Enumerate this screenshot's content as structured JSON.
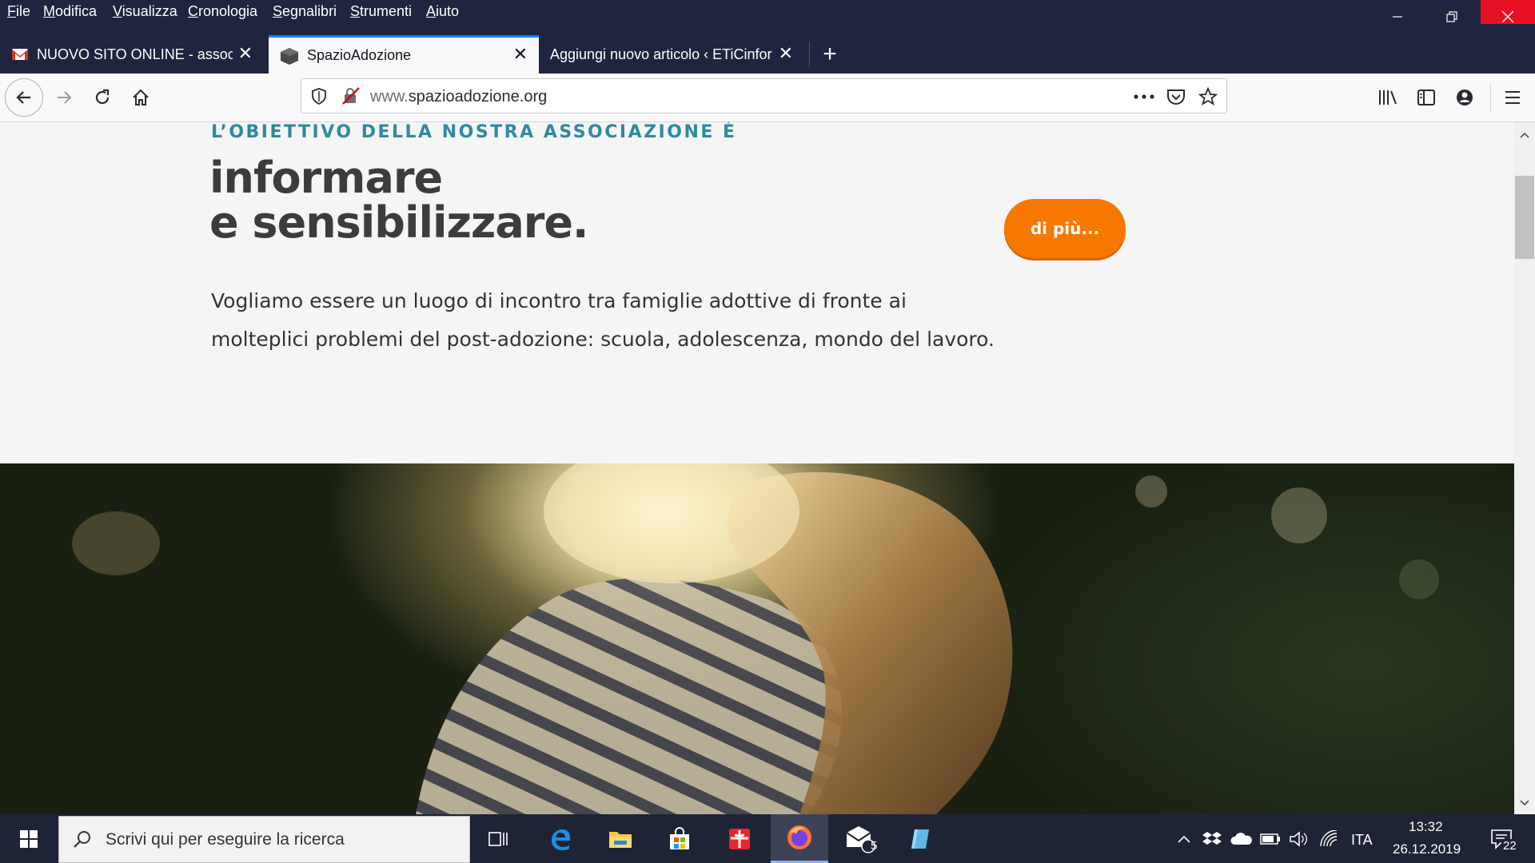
{
  "menubar": {
    "items": [
      "File",
      "Modifica",
      "Visualizza",
      "Cronologia",
      "Segnalibri",
      "Strumenti",
      "Aiuto"
    ]
  },
  "tabs": [
    {
      "label": "NUOVO SITO ONLINE - associa",
      "icon": "gmail-icon",
      "active": false
    },
    {
      "label": "SpazioAdozione",
      "icon": "site-cube-icon",
      "active": true
    },
    {
      "label": "Aggiungi nuovo articolo ‹ ETiCinfor",
      "icon": "",
      "active": false
    }
  ],
  "navbar": {
    "url_prefix": "www.",
    "url_host": "spazioadozione.org"
  },
  "page": {
    "eyebrow": "L’OBIETTIVO DELLA NOSTRA ASSOCIAZIONE È",
    "headline_line1": "informare",
    "headline_line2": "e sensibilizzare.",
    "more_button": "di più...",
    "intro": "Vogliamo essere un luogo di incontro tra famiglie adottive di fronte ai molteplici problemi del post-adozione: scuola, adolescenza, mondo del lavoro.",
    "accent_color": "#f77800",
    "eyebrow_color": "#2f8a9c"
  },
  "taskbar": {
    "search_placeholder": "Scrivi qui per eseguire la ricerca",
    "mail_badge": "5",
    "language": "ITA",
    "time": "13:32",
    "date": "26.12.2019",
    "notifications": "22"
  }
}
